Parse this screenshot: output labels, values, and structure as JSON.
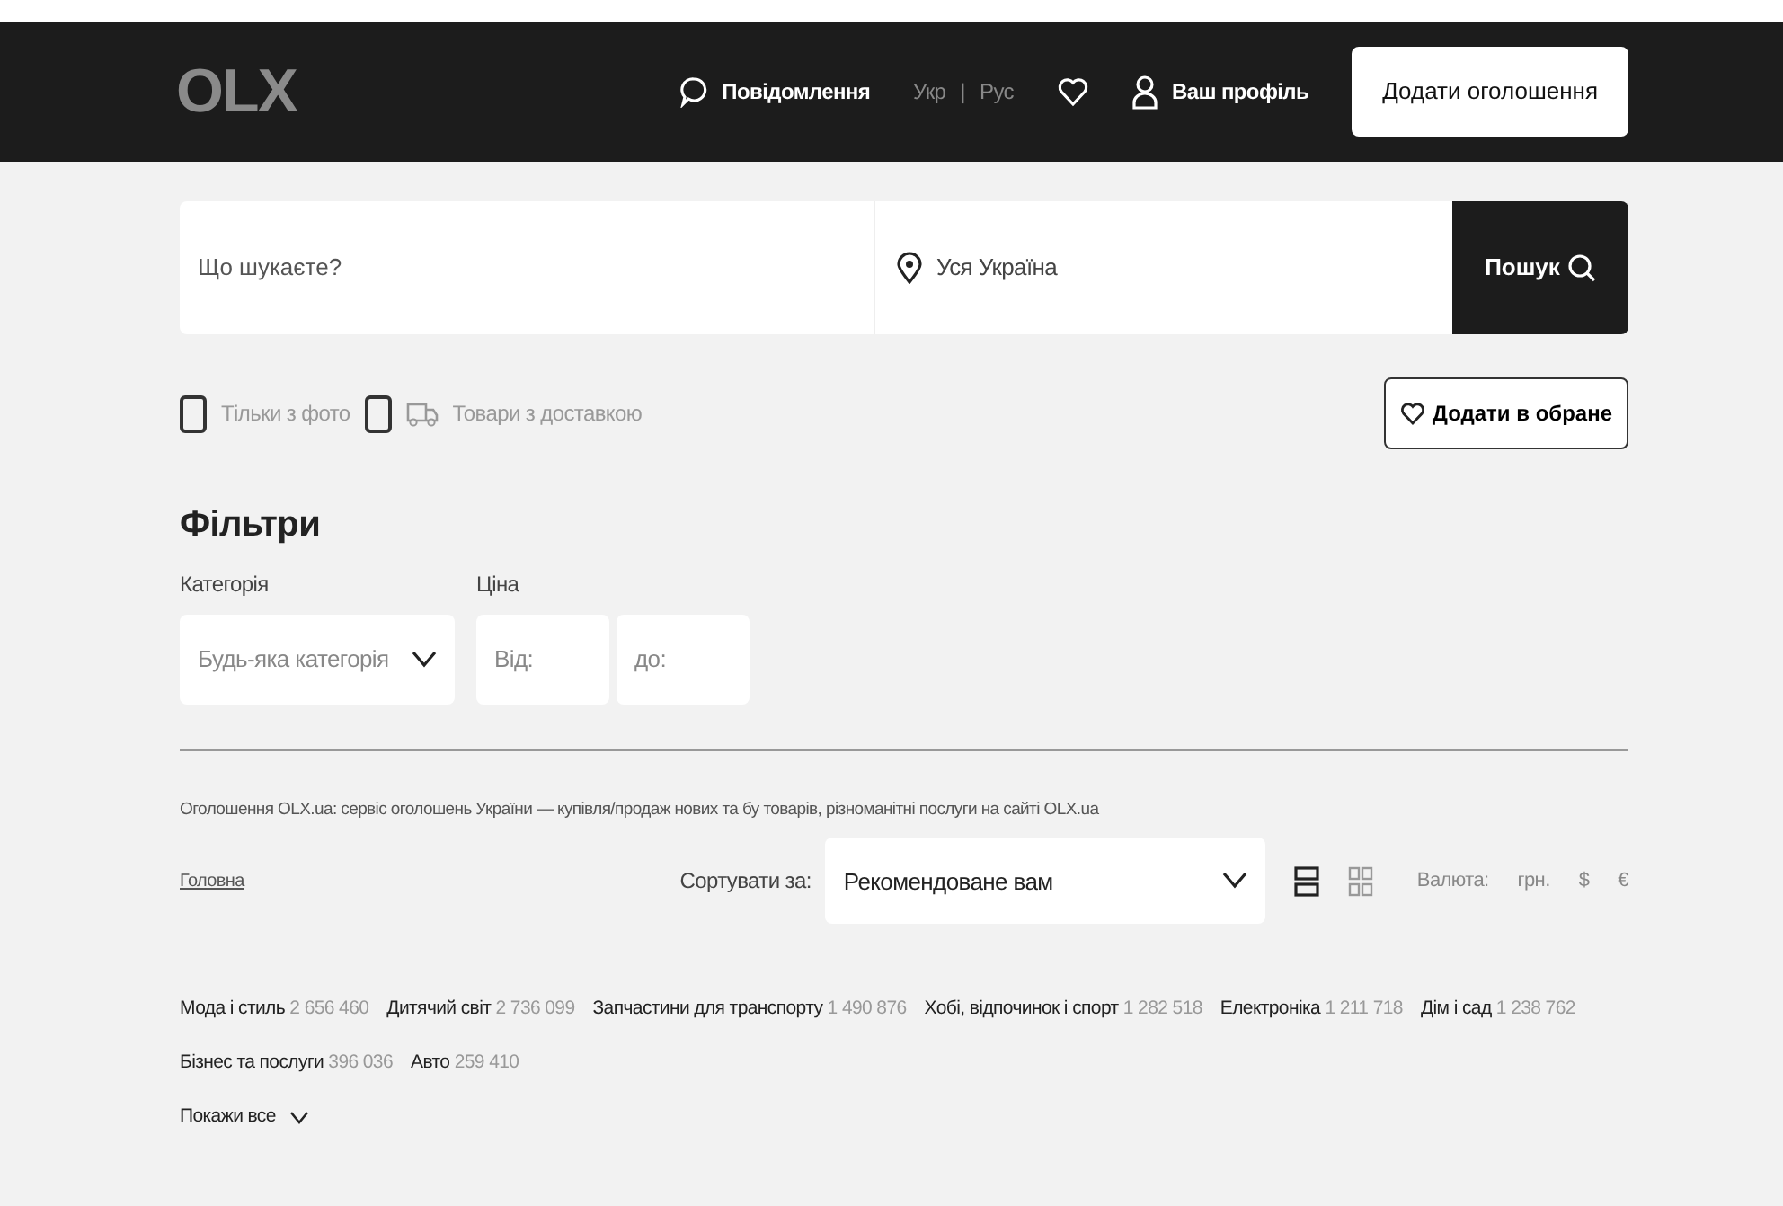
{
  "header": {
    "logo": "OLX",
    "messages": "Повідомлення",
    "languages": [
      {
        "label": "Укр",
        "selected": false
      },
      {
        "label": "Рус",
        "selected": false
      }
    ],
    "language_divider": "|",
    "profile": "Ваш профіль",
    "post_button": "Додати оголошення"
  },
  "search": {
    "placeholder": "Що шукаєте?",
    "location": "Уся Україна",
    "button": "Пошук"
  },
  "options": [
    {
      "label": "Тільки з фото",
      "checked": false,
      "kind": "plain"
    },
    {
      "label": "Товари з доставкою",
      "checked": false,
      "kind": "delivery"
    }
  ],
  "favorite_button": "Додати в обране",
  "filters": {
    "title": "Фільтри",
    "category_label": "Категорія",
    "category_value": "Будь-яка категорія",
    "price_label": "Ціна",
    "price_from": "Від:",
    "price_to": "до:"
  },
  "description": "Оголошення OLX.ua: сервіс оголошень України — купівля/продаж нових та бу товарів, різноманітні послуги на сайті OLX.ua",
  "breadcrumb": "Головна",
  "sort": {
    "label": "Сортувати за:",
    "value": "Рекомендоване вам"
  },
  "views": [
    {
      "kind": "list",
      "selected": true
    },
    {
      "kind": "grid",
      "selected": false
    }
  ],
  "currency": {
    "label": "Валюта:",
    "options": [
      "грн.",
      "$",
      "€"
    ]
  },
  "categories": [
    {
      "name": "Мода і стиль",
      "count": "2 656 460"
    },
    {
      "name": "Дитячий світ",
      "count": "2 736 099"
    },
    {
      "name": "Запчастини для транспорту",
      "count": "1 490 876"
    },
    {
      "name": "Хобі, відпочинок і спорт",
      "count": "1 282 518"
    },
    {
      "name": "Електроніка",
      "count": "1 211 718"
    },
    {
      "name": "Дім і сад",
      "count": "1 238 762"
    },
    {
      "name": "Бізнес та послуги",
      "count": "396 036"
    },
    {
      "name": "Авто",
      "count": "259 410"
    }
  ],
  "show_all": "Покажи все"
}
